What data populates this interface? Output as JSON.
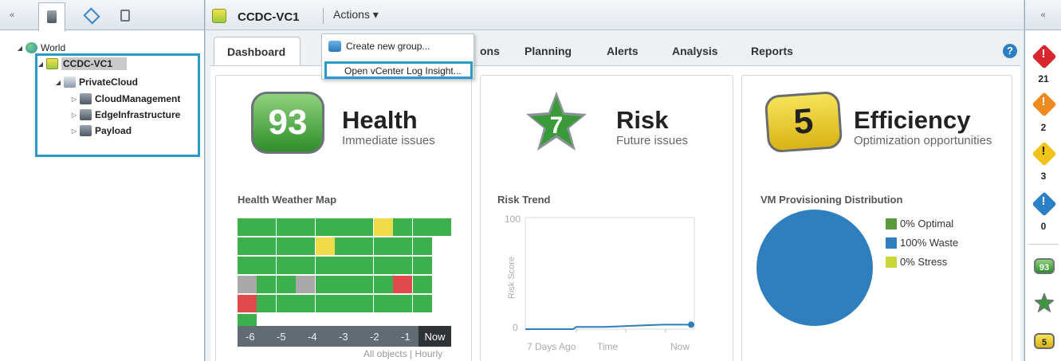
{
  "tree": {
    "world": "World",
    "vcenter": "CCDC-VC1",
    "datacenter": "PrivateCloud",
    "clusters": [
      "CloudManagement",
      "EdgeInfrastructure",
      "Payload"
    ]
  },
  "header": {
    "title": "CCDC-VC1",
    "actions": "Actions ▾"
  },
  "dropdown": {
    "items": [
      "Create new group...",
      "Open vCenter Log Insight..."
    ]
  },
  "tabs": [
    "Dashboard",
    "ons",
    "Planning",
    "Alerts",
    "Analysis",
    "Reports"
  ],
  "health": {
    "score": "93",
    "title": "Health",
    "subtitle": "Immediate issues",
    "map_title": "Health Weather Map",
    "axis": [
      "-6",
      "-5",
      "-4",
      "-3",
      "-2",
      "-1",
      "Now"
    ],
    "footer": "All objects | Hourly",
    "colors": {
      "green": "#3cb04c",
      "yellow": "#f0dc4a",
      "red": "#e04a4a",
      "gray": "#a9a9a9"
    }
  },
  "risk": {
    "score": "7",
    "title": "Risk",
    "subtitle": "Future issues",
    "trend_title": "Risk Trend",
    "y_label": "Risk Score",
    "y_ticks": [
      "100",
      "0"
    ],
    "x_ticks": [
      "7 Days Ago",
      "Time",
      "Now"
    ]
  },
  "efficiency": {
    "score": "5",
    "title": "Efficiency",
    "subtitle": "Optimization opportunities",
    "dist_title": "VM Provisioning Distribution",
    "legend": [
      "0% Optimal",
      "100% Waste",
      "0% Stress"
    ],
    "legend_colors": [
      "#5a9a3c",
      "#2f7fbf",
      "#c8d63a"
    ]
  },
  "chart_data": [
    {
      "type": "line",
      "title": "Risk Trend",
      "ylabel": "Risk Score",
      "ylim": [
        0,
        100
      ],
      "x": [
        "7 Days Ago",
        "Time",
        "Now"
      ],
      "series": [
        {
          "values": [
            0,
            0,
            2,
            2,
            3,
            4,
            4
          ]
        }
      ]
    },
    {
      "type": "pie",
      "title": "VM Provisioning Distribution",
      "categories": [
        "Optimal",
        "Waste",
        "Stress"
      ],
      "values": [
        0,
        100,
        0
      ]
    }
  ],
  "alerts": {
    "counts": [
      "21",
      "2",
      "3",
      "0"
    ],
    "colors": [
      "#d8262e",
      "#ef8a21",
      "#f0c419",
      "#2b7fc4"
    ]
  },
  "mini_badges": [
    "93",
    "",
    "5"
  ]
}
